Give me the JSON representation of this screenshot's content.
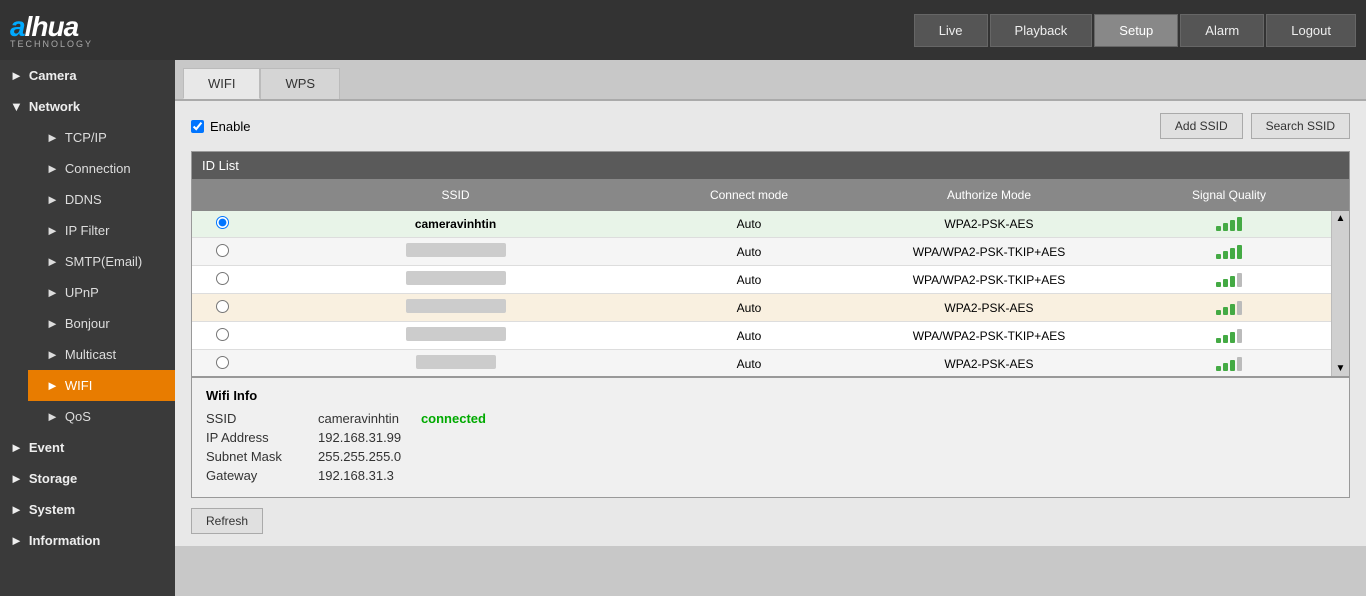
{
  "header": {
    "logo": "alhua",
    "logo_sub": "TECHNOLOGY",
    "nav": [
      {
        "label": "Live",
        "active": false
      },
      {
        "label": "Playback",
        "active": false
      },
      {
        "label": "Setup",
        "active": true
      },
      {
        "label": "Alarm",
        "active": false
      },
      {
        "label": "Logout",
        "active": false
      }
    ]
  },
  "sidebar": {
    "sections": [
      {
        "label": "Camera",
        "expanded": true,
        "items": []
      },
      {
        "label": "Network",
        "expanded": true,
        "items": [
          {
            "label": "TCP/IP"
          },
          {
            "label": "Connection"
          },
          {
            "label": "DDNS"
          },
          {
            "label": "IP Filter"
          },
          {
            "label": "SMTP(Email)"
          },
          {
            "label": "UPnP"
          },
          {
            "label": "Bonjour"
          },
          {
            "label": "Multicast"
          },
          {
            "label": "WIFI",
            "active": true
          },
          {
            "label": "QoS"
          }
        ]
      },
      {
        "label": "Event",
        "expanded": false,
        "items": []
      },
      {
        "label": "Storage",
        "expanded": false,
        "items": []
      },
      {
        "label": "System",
        "expanded": false,
        "items": []
      },
      {
        "label": "Information",
        "expanded": false,
        "items": []
      }
    ]
  },
  "tabs": [
    {
      "label": "WIFI",
      "active": true
    },
    {
      "label": "WPS",
      "active": false
    }
  ],
  "enable": {
    "label": "Enable",
    "checked": true
  },
  "buttons": {
    "add_ssid": "Add SSID",
    "search_ssid": "Search SSID",
    "refresh": "Refresh"
  },
  "table": {
    "id_list_label": "ID List",
    "columns": [
      "",
      "SSID",
      "Connect mode",
      "Authorize Mode",
      "Signal Quality",
      ""
    ],
    "rows": [
      {
        "ssid": "cameravinhtin",
        "ssid_visible": true,
        "connect_mode": "Auto",
        "auth_mode": "WPA2-PSK-AES",
        "signal": 4,
        "selected": true
      },
      {
        "ssid": "",
        "ssid_visible": false,
        "connect_mode": "Auto",
        "auth_mode": "WPA/WPA2-PSK-TKIP+AES",
        "signal": 4,
        "selected": false
      },
      {
        "ssid": "",
        "ssid_visible": false,
        "connect_mode": "Auto",
        "auth_mode": "WPA/WPA2-PSK-TKIP+AES",
        "signal": 3,
        "selected": false
      },
      {
        "ssid": "",
        "ssid_visible": false,
        "connect_mode": "Auto",
        "auth_mode": "WPA2-PSK-AES",
        "signal": 3,
        "selected": false
      },
      {
        "ssid": "",
        "ssid_visible": false,
        "connect_mode": "Auto",
        "auth_mode": "WPA/WPA2-PSK-TKIP+AES",
        "signal": 3,
        "selected": false
      },
      {
        "ssid": "",
        "ssid_visible": false,
        "connect_mode": "Auto",
        "auth_mode": "WPA2-PSK-AES",
        "signal": 3,
        "selected": false
      }
    ]
  },
  "wifi_info": {
    "title": "Wifi Info",
    "ssid_label": "SSID",
    "ssid_value": "cameravinhtin",
    "connected_label": "connected",
    "ip_label": "IP Address",
    "ip_value": "192.168.31.99",
    "subnet_label": "Subnet Mask",
    "subnet_value": "255.255.255.0",
    "gateway_label": "Gateway",
    "gateway_value": "192.168.31.3"
  }
}
